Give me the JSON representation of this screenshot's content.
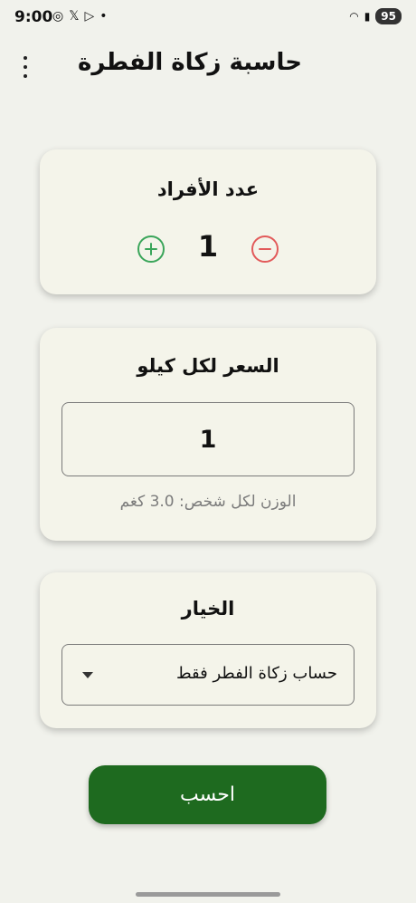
{
  "status_bar": {
    "time": "9:00",
    "notif_icons": [
      "whatsapp-icon",
      "x-icon",
      "play-icon",
      "dot-icon"
    ],
    "battery": "95"
  },
  "app": {
    "title": "حاسبة زكاة الفطرة"
  },
  "people_card": {
    "title": "عدد الأفراد",
    "count": "1"
  },
  "price_card": {
    "title": "السعر لكل كيلو",
    "price_value": "1",
    "weight_note": "الوزن لكل شخص: 3.0 كغم"
  },
  "option_card": {
    "title": "الخيار",
    "selected": "حساب زكاة الفطر فقط"
  },
  "calculate_button": {
    "label": "احسب"
  },
  "colors": {
    "background": "#f1f2ec",
    "card": "#f4f4ea",
    "plus": "#3aa55a",
    "minus": "#e25a5a",
    "primary_button": "#1e6a1f"
  }
}
